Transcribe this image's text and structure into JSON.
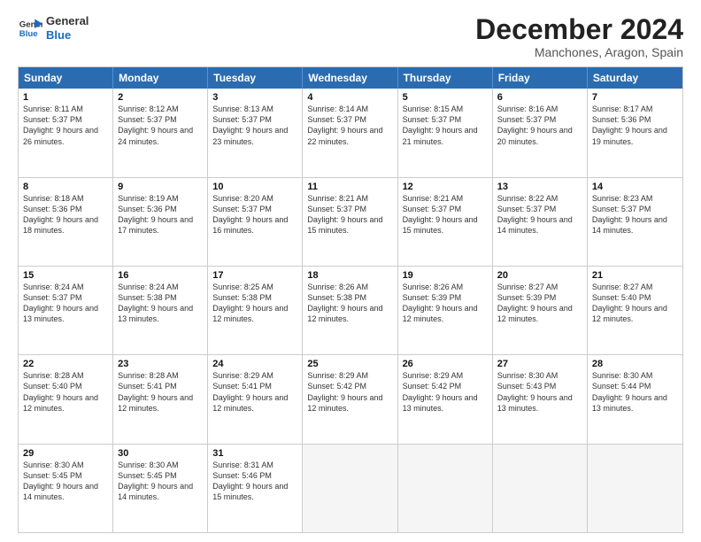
{
  "logo": {
    "line1": "General",
    "line2": "Blue"
  },
  "title": "December 2024",
  "subtitle": "Manchones, Aragon, Spain",
  "headers": [
    "Sunday",
    "Monday",
    "Tuesday",
    "Wednesday",
    "Thursday",
    "Friday",
    "Saturday"
  ],
  "weeks": [
    [
      {
        "day": "1",
        "sunrise": "8:11 AM",
        "sunset": "5:37 PM",
        "daylight": "9 hours and 26 minutes."
      },
      {
        "day": "2",
        "sunrise": "8:12 AM",
        "sunset": "5:37 PM",
        "daylight": "9 hours and 24 minutes."
      },
      {
        "day": "3",
        "sunrise": "8:13 AM",
        "sunset": "5:37 PM",
        "daylight": "9 hours and 23 minutes."
      },
      {
        "day": "4",
        "sunrise": "8:14 AM",
        "sunset": "5:37 PM",
        "daylight": "9 hours and 22 minutes."
      },
      {
        "day": "5",
        "sunrise": "8:15 AM",
        "sunset": "5:37 PM",
        "daylight": "9 hours and 21 minutes."
      },
      {
        "day": "6",
        "sunrise": "8:16 AM",
        "sunset": "5:37 PM",
        "daylight": "9 hours and 20 minutes."
      },
      {
        "day": "7",
        "sunrise": "8:17 AM",
        "sunset": "5:36 PM",
        "daylight": "9 hours and 19 minutes."
      }
    ],
    [
      {
        "day": "8",
        "sunrise": "8:18 AM",
        "sunset": "5:36 PM",
        "daylight": "9 hours and 18 minutes."
      },
      {
        "day": "9",
        "sunrise": "8:19 AM",
        "sunset": "5:36 PM",
        "daylight": "9 hours and 17 minutes."
      },
      {
        "day": "10",
        "sunrise": "8:20 AM",
        "sunset": "5:37 PM",
        "daylight": "9 hours and 16 minutes."
      },
      {
        "day": "11",
        "sunrise": "8:21 AM",
        "sunset": "5:37 PM",
        "daylight": "9 hours and 15 minutes."
      },
      {
        "day": "12",
        "sunrise": "8:21 AM",
        "sunset": "5:37 PM",
        "daylight": "9 hours and 15 minutes."
      },
      {
        "day": "13",
        "sunrise": "8:22 AM",
        "sunset": "5:37 PM",
        "daylight": "9 hours and 14 minutes."
      },
      {
        "day": "14",
        "sunrise": "8:23 AM",
        "sunset": "5:37 PM",
        "daylight": "9 hours and 14 minutes."
      }
    ],
    [
      {
        "day": "15",
        "sunrise": "8:24 AM",
        "sunset": "5:37 PM",
        "daylight": "9 hours and 13 minutes."
      },
      {
        "day": "16",
        "sunrise": "8:24 AM",
        "sunset": "5:38 PM",
        "daylight": "9 hours and 13 minutes."
      },
      {
        "day": "17",
        "sunrise": "8:25 AM",
        "sunset": "5:38 PM",
        "daylight": "9 hours and 12 minutes."
      },
      {
        "day": "18",
        "sunrise": "8:26 AM",
        "sunset": "5:38 PM",
        "daylight": "9 hours and 12 minutes."
      },
      {
        "day": "19",
        "sunrise": "8:26 AM",
        "sunset": "5:39 PM",
        "daylight": "9 hours and 12 minutes."
      },
      {
        "day": "20",
        "sunrise": "8:27 AM",
        "sunset": "5:39 PM",
        "daylight": "9 hours and 12 minutes."
      },
      {
        "day": "21",
        "sunrise": "8:27 AM",
        "sunset": "5:40 PM",
        "daylight": "9 hours and 12 minutes."
      }
    ],
    [
      {
        "day": "22",
        "sunrise": "8:28 AM",
        "sunset": "5:40 PM",
        "daylight": "9 hours and 12 minutes."
      },
      {
        "day": "23",
        "sunrise": "8:28 AM",
        "sunset": "5:41 PM",
        "daylight": "9 hours and 12 minutes."
      },
      {
        "day": "24",
        "sunrise": "8:29 AM",
        "sunset": "5:41 PM",
        "daylight": "9 hours and 12 minutes."
      },
      {
        "day": "25",
        "sunrise": "8:29 AM",
        "sunset": "5:42 PM",
        "daylight": "9 hours and 12 minutes."
      },
      {
        "day": "26",
        "sunrise": "8:29 AM",
        "sunset": "5:42 PM",
        "daylight": "9 hours and 13 minutes."
      },
      {
        "day": "27",
        "sunrise": "8:30 AM",
        "sunset": "5:43 PM",
        "daylight": "9 hours and 13 minutes."
      },
      {
        "day": "28",
        "sunrise": "8:30 AM",
        "sunset": "5:44 PM",
        "daylight": "9 hours and 13 minutes."
      }
    ],
    [
      {
        "day": "29",
        "sunrise": "8:30 AM",
        "sunset": "5:45 PM",
        "daylight": "9 hours and 14 minutes."
      },
      {
        "day": "30",
        "sunrise": "8:30 AM",
        "sunset": "5:45 PM",
        "daylight": "9 hours and 14 minutes."
      },
      {
        "day": "31",
        "sunrise": "8:31 AM",
        "sunset": "5:46 PM",
        "daylight": "9 hours and 15 minutes."
      },
      null,
      null,
      null,
      null
    ]
  ]
}
